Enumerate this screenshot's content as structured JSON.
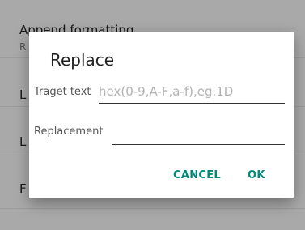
{
  "background": {
    "items": [
      {
        "title": "Append formatting",
        "subtitle": "R"
      },
      {
        "title": "L",
        "subtitle": ""
      },
      {
        "title": "L",
        "subtitle": ""
      },
      {
        "title": "F",
        "subtitle": ""
      },
      {
        "title": "",
        "subtitle": ""
      }
    ]
  },
  "dialog": {
    "title": "Replace",
    "target_label": "Traget text",
    "target_value": "",
    "target_placeholder": "hex(0-9,A-F,a-f),eg.1D",
    "replacement_label": "Replacement",
    "replacement_value": "",
    "cancel_label": "CANCEL",
    "ok_label": "OK"
  },
  "colors": {
    "accent": "#00897b",
    "scrim": "rgba(0,0,0,0.32)"
  }
}
